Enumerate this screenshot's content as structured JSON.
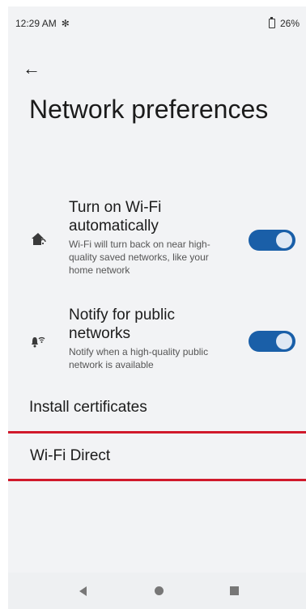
{
  "status_bar": {
    "time": "12:29 AM",
    "battery": "26%"
  },
  "page": {
    "title": "Network preferences"
  },
  "settings": [
    {
      "title": "Turn on Wi-Fi automatically",
      "summary": "Wi-Fi will turn back on near high-quality saved networks, like your home network",
      "icon": "wifi-home-icon",
      "enabled": true
    },
    {
      "title": "Notify for public networks",
      "summary": "Notify when a high-quality public network is available",
      "icon": "wifi-notify-icon",
      "enabled": true
    }
  ],
  "links": [
    {
      "label": "Install certificates"
    },
    {
      "label": "Wi-Fi Direct"
    }
  ],
  "colors": {
    "accent": "#1a5fa8",
    "highlight": "#d0192b",
    "background": "#f2f3f5"
  }
}
